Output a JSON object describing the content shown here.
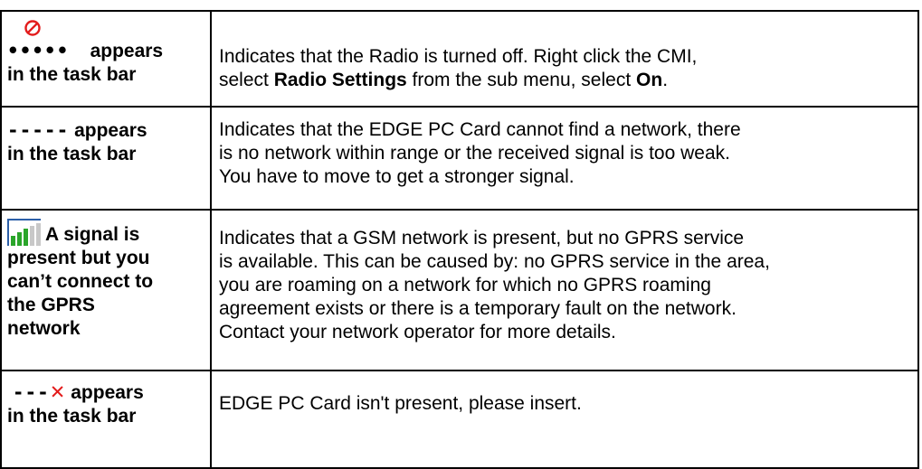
{
  "rows": [
    {
      "icon_dashes": "•••••",
      "label_a": "appears",
      "label_b": "in the task bar",
      "desc_1": "Indicates that the Radio is turned off. Right click the CMI,",
      "desc_2_pre": "select ",
      "desc_2_bold": "Radio Settings",
      "desc_2_mid": " from the sub menu, select ",
      "desc_2_bold2": "On",
      "desc_2_end": "."
    },
    {
      "icon_dashes": "-----",
      "label_a": "appears",
      "label_b": "in the task bar",
      "desc_1": "Indicates that the EDGE PC Card cannot find a network, there",
      "desc_2": "is no network within range or the received signal is too weak.",
      "desc_3": "You have to move to get a stronger signal."
    },
    {
      "label_a": "A signal is",
      "label_b": "present but you",
      "label_c": "can’t connect to",
      "label_d": "the GPRS",
      "label_e": "network",
      "desc_1": "Indicates that a GSM network is present, but no GPRS service",
      "desc_2": "is available. This can be caused by: no GPRS service in the area,",
      "desc_3": "you are roaming on a network for which no GPRS roaming",
      "desc_4": "agreement exists or there is a temporary fault on the network.",
      "desc_5": "Contact your network operator for more details."
    },
    {
      "icon_dashes": "---",
      "icon_x": "✕",
      "label_a": "appears",
      "label_b": "in the task bar",
      "desc_1": "EDGE PC Card isn't present, please insert."
    }
  ],
  "colors": {
    "no_entry": "#e31b1b",
    "x_mark": "#e31b1b",
    "signal_green": "#2aa52a",
    "signal_grey": "#c8c8c8",
    "signal_frame": "#2c5fa8"
  }
}
